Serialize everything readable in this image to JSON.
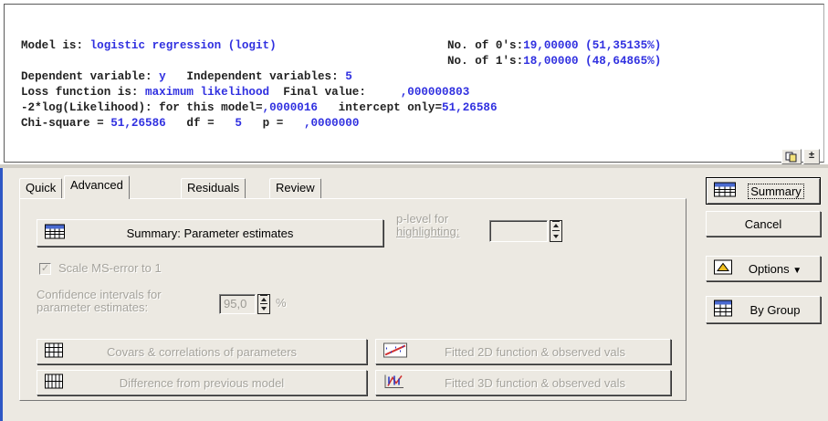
{
  "results": {
    "line1_label": "Model is: ",
    "line1_value": "logistic regression (logit)",
    "line1_zeros_label": "No. of 0's:",
    "line1_zeros_value": "19,00000 (51,35135%)",
    "line2_ones_label": "No. of 1's:",
    "line2_ones_value": "18,00000 (48,64865%)",
    "line3_dep_label": "Dependent variable: ",
    "line3_dep_value": "y",
    "line3_indep_label": "Independent variables: ",
    "line3_indep_value": "5",
    "line4_loss_label": "Loss function is: ",
    "line4_loss_value": "maximum likelihood",
    "line4_final_label": "Final value: ",
    "line4_final_value": ",000000803",
    "line5_label": "-2*log(Likelihood): for this model=",
    "line5_value": ",0000016",
    "line5_intercept_label": "intercept only=",
    "line5_intercept_value": "51,26586",
    "line6_chi_label": "Chi-square = ",
    "line6_chi_value": "51,26586",
    "line6_df_label": "df = ",
    "line6_df_value": "5",
    "line6_p_label": "p = ",
    "line6_p_value": ",0000000",
    "copy_icon": "copy-icon",
    "collapse_label": "±"
  },
  "tabs": [
    "Quick",
    "Advanced",
    "Residuals",
    "Review"
  ],
  "active_tab": "Advanced",
  "advanced": {
    "summary_param_button": "Summary: Parameter estimates",
    "plevel_label_line1": "p-level for",
    "plevel_label_line2": "highlighting:",
    "plevel_value": "",
    "scale_ms_label": "Scale MS-error to 1",
    "scale_ms_checked": true,
    "conf_label_line1": "Confidence intervals for",
    "conf_label_line2": "parameter estimates:",
    "conf_value": "95,0",
    "conf_unit": "%",
    "covars_button": "Covars & correlations of parameters",
    "fitted2d_button": "Fitted 2D function & observed vals",
    "difference_button": "Difference from previous model",
    "fitted3d_button": "Fitted 3D function & observed vals"
  },
  "side_buttons": {
    "summary": "Summary",
    "cancel": "Cancel",
    "options": "Options",
    "by_group": "By Group"
  },
  "colors": {
    "value_blue": "#3030e0",
    "dialog_bg": "#ece9e2",
    "left_accent": "#2f57c5"
  }
}
